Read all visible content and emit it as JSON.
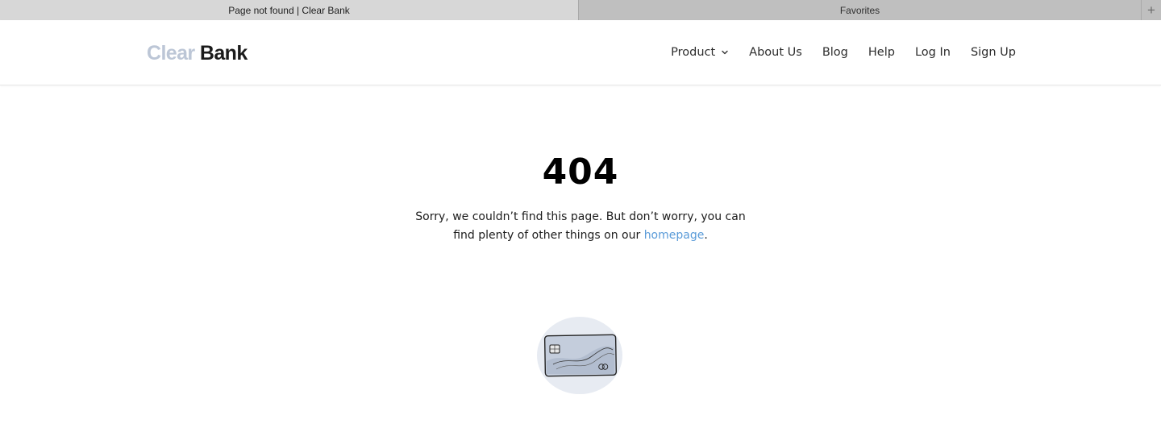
{
  "browser": {
    "tabs": [
      {
        "label": "Page not found | Clear Bank",
        "active": true
      },
      {
        "label": "Favorites",
        "active": false
      }
    ],
    "new_tab_icon": "plus-icon"
  },
  "header": {
    "logo": {
      "part1": "Clear",
      "part2": "Bank"
    },
    "nav": [
      {
        "label": "Product",
        "has_dropdown": true
      },
      {
        "label": "About Us"
      },
      {
        "label": "Blog"
      },
      {
        "label": "Help"
      },
      {
        "label": "Log In"
      },
      {
        "label": "Sign Up"
      }
    ]
  },
  "main": {
    "code": "404",
    "message_before": "Sorry, we couldn’t find this page. But don’t worry, you can find plenty of other things on our ",
    "link_text": "homepage",
    "message_after": ".",
    "illustration": "credit-card-illustration"
  },
  "colors": {
    "logo_light": "#bcc6d6",
    "logo_dark": "#1b1b1b",
    "link": "#5a9bd8"
  }
}
